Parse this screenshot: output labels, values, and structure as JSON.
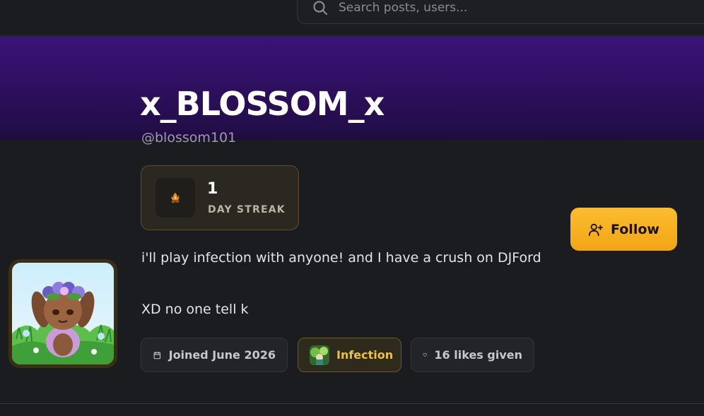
{
  "search": {
    "placeholder": "Search posts, users..."
  },
  "profile": {
    "display_name": "x_BLOSSOM_x",
    "handle": "@blossom101",
    "bio_lines": [
      "i'll play infection with anyone! and I have a crush on DJFord",
      "XD no one tell k"
    ]
  },
  "streak": {
    "count": "1",
    "label": "DAY STREAK",
    "icon": "campfire-icon"
  },
  "follow": {
    "label": "Follow",
    "icon": "user-plus-icon"
  },
  "chips": {
    "joined": {
      "label": "Joined June 2026",
      "icon": "calendar-icon"
    },
    "game": {
      "label": "Infection",
      "icon": "game-thumbnail"
    },
    "likes": {
      "label": "16 likes given",
      "icon": "heart-icon"
    }
  },
  "colors": {
    "banner_top": "#3b1378",
    "accent_gold": "#fbbd2e",
    "game_chip_text": "#f0c23a",
    "background": "#1b1c20"
  }
}
